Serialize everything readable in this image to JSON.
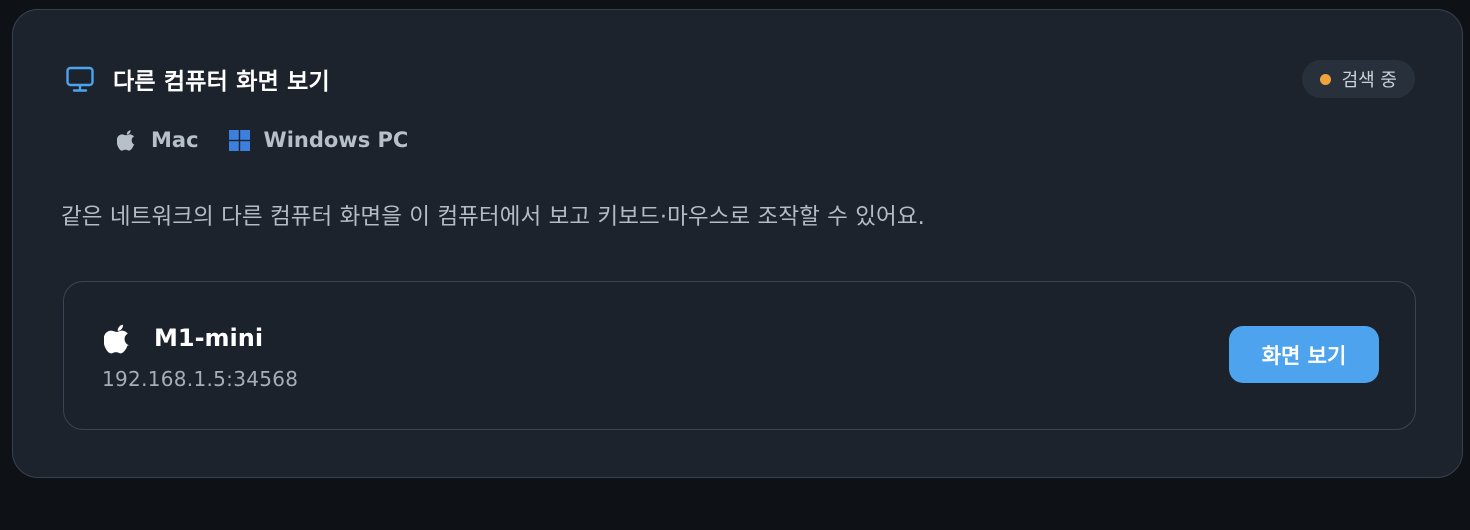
{
  "header": {
    "title": "다른 컴퓨터 화면 보기",
    "icon": "monitor-icon",
    "accent_color": "#4da3ee"
  },
  "status": {
    "label": "검색 중",
    "dot_color": "#f0a33a"
  },
  "platforms": [
    {
      "label": "Mac",
      "icon": "apple-icon"
    },
    {
      "label": "Windows PC",
      "icon": "windows-icon"
    }
  ],
  "description": "같은 네트워크의 다른 컴퓨터 화면을 이 컴퓨터에서 보고 키보드·마우스로 조작할 수 있어요.",
  "devices": [
    {
      "name": "M1-mini",
      "address": "192.168.1.5:34568",
      "icon": "apple-icon",
      "action_label": "화면 보기"
    }
  ]
}
